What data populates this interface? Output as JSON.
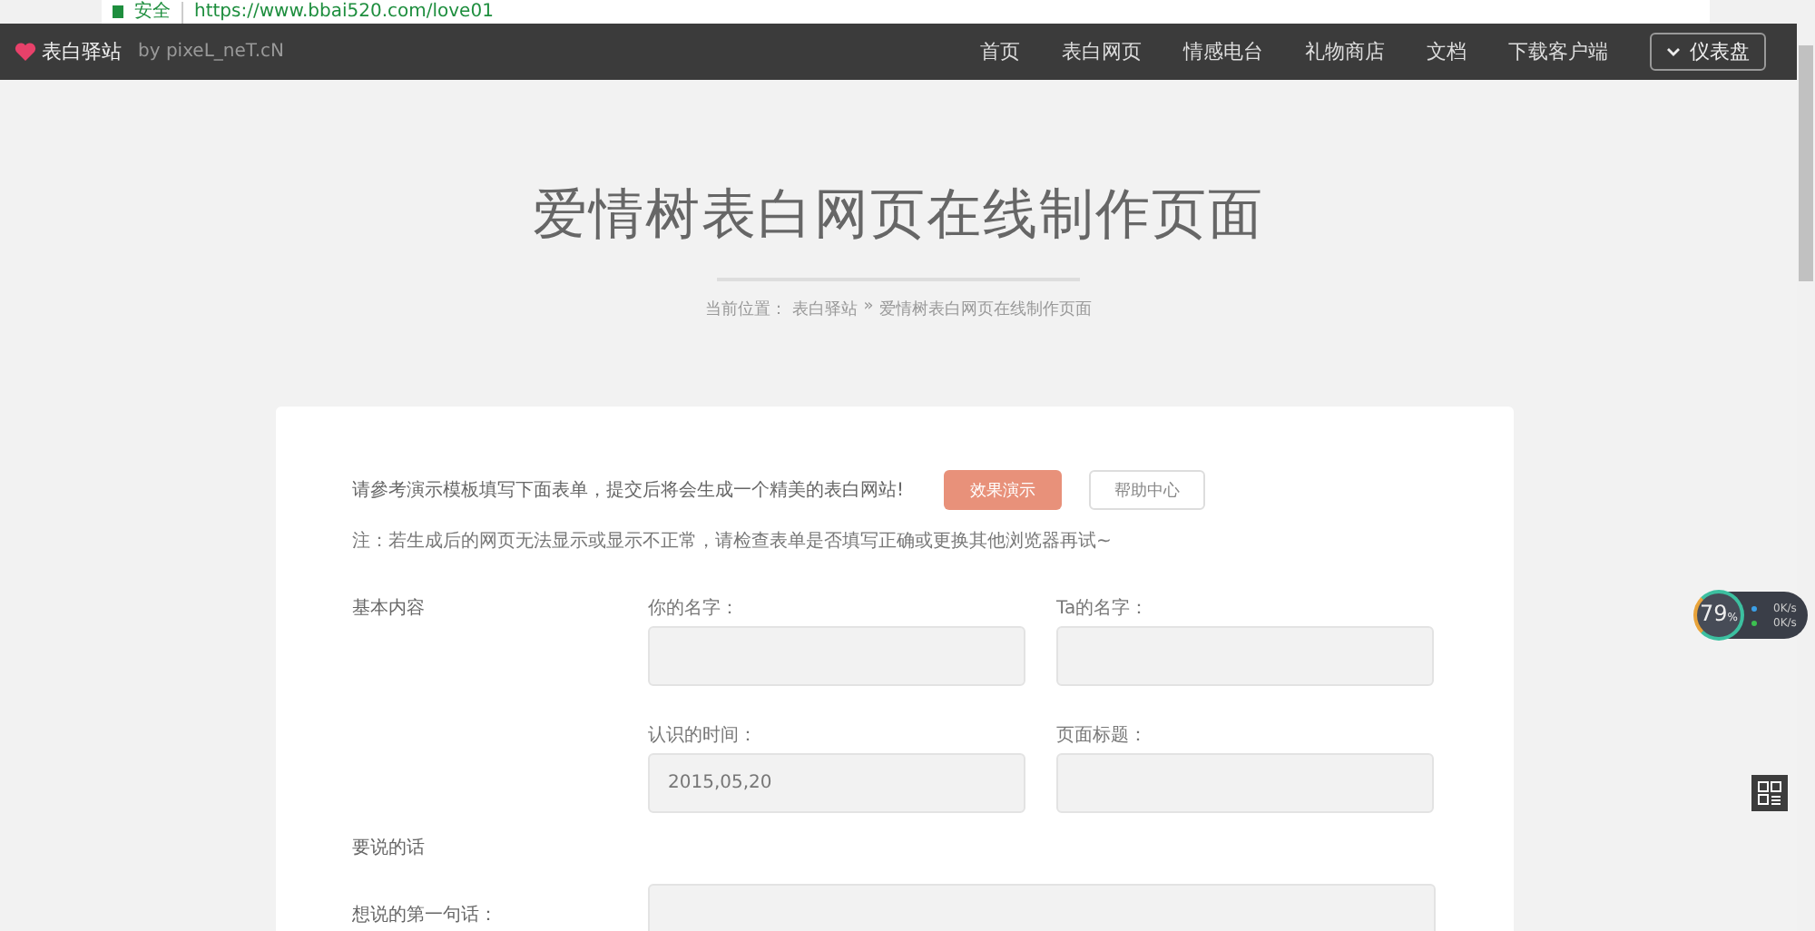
{
  "browser": {
    "secure_label": "安全",
    "url": "https://www.bbai520.com/love01"
  },
  "navbar": {
    "brand": "表白驿站",
    "byline": "by pixeL_neT.cN",
    "items": [
      {
        "label": "首页"
      },
      {
        "label": "表白网页"
      },
      {
        "label": "情感电台"
      },
      {
        "label": "礼物商店"
      },
      {
        "label": "文档"
      },
      {
        "label": "下载客户端"
      }
    ],
    "dashboard_button": "仪表盘"
  },
  "page_title": "爱情树表白网页在线制作页面",
  "breadcrumb": {
    "prefix": "当前位置：",
    "home": "表白驿站",
    "separator": "»",
    "current": "爱情树表白网页在线制作页面"
  },
  "form": {
    "intro": "请參考演示模板填写下面表单，提交后将会生成一个精美的表白网站!",
    "demo_button": "效果演示",
    "help_button": "帮助中心",
    "note": "注：若生成后的网页无法显示或显示不正常，请检查表单是否填写正确或更换其他浏览器再试~",
    "sections": [
      {
        "title": "基本内容",
        "fields": [
          {
            "label": "你的名字："
          },
          {
            "label": "Ta的名字："
          },
          {
            "label": "认识的时间：",
            "value": "2015,05,20"
          },
          {
            "label": "页面标题："
          }
        ]
      },
      {
        "title": "要说的话",
        "wide_fields": [
          {
            "label": "想说的第一句话："
          }
        ]
      }
    ]
  },
  "speed_widget": {
    "percent": "79",
    "unit": "%",
    "upload": "0K/s",
    "download": "0K/s"
  }
}
